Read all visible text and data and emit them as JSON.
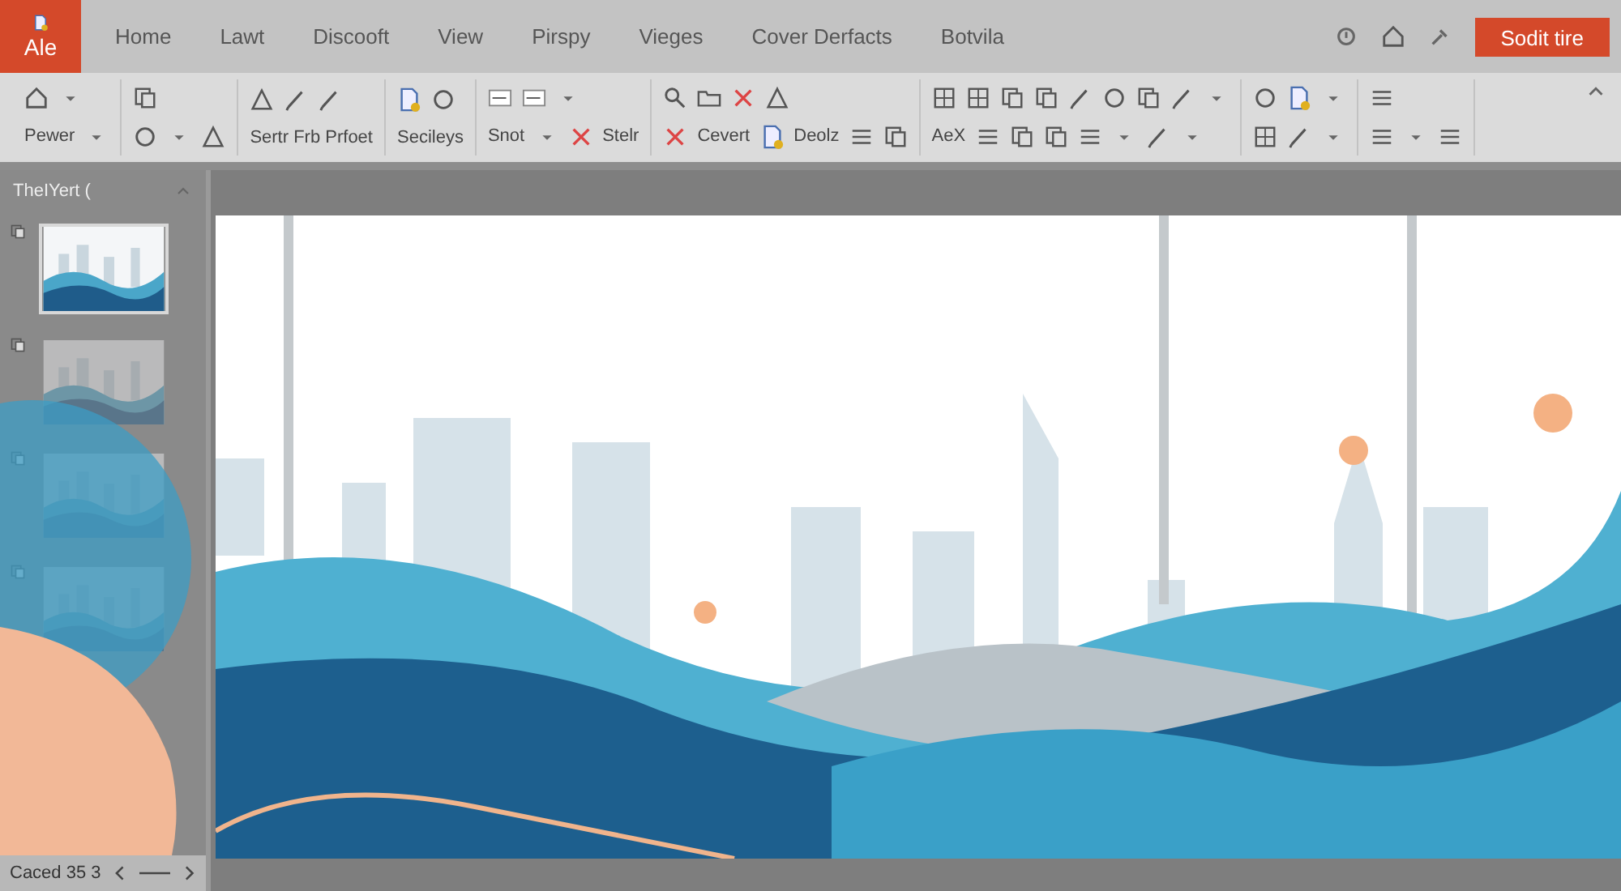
{
  "app_tab": {
    "label": "Ale"
  },
  "menu": [
    {
      "label": "Home",
      "selected": false
    },
    {
      "label": "Lawt",
      "selected": false
    },
    {
      "label": "Discooft",
      "selected": false
    },
    {
      "label": "View",
      "selected": false
    },
    {
      "label": "Pirspy",
      "selected": false
    },
    {
      "label": "Vieges",
      "selected": false
    },
    {
      "label": "Cover Derfacts",
      "selected": false
    },
    {
      "label": "Botvila",
      "selected": false
    }
  ],
  "share_button": {
    "label": "Sodit tire"
  },
  "ribbon": {
    "groups": [
      {
        "labels": [
          "Pewer"
        ]
      },
      {
        "labels": [
          "Sertr Frb Prfoet"
        ]
      },
      {
        "labels": [
          "Secileys"
        ]
      },
      {
        "labels": [
          "Snot",
          "Stelr"
        ]
      },
      {
        "labels": [
          "Cevert",
          "Deolz"
        ]
      },
      {
        "labels": [
          "AeX"
        ]
      }
    ]
  },
  "slides_panel": {
    "title": "TheIYert (",
    "slides": [
      {
        "selected": true
      },
      {
        "selected": false
      },
      {
        "selected": false
      },
      {
        "selected": false
      }
    ],
    "footer": "Caced 35 3"
  }
}
